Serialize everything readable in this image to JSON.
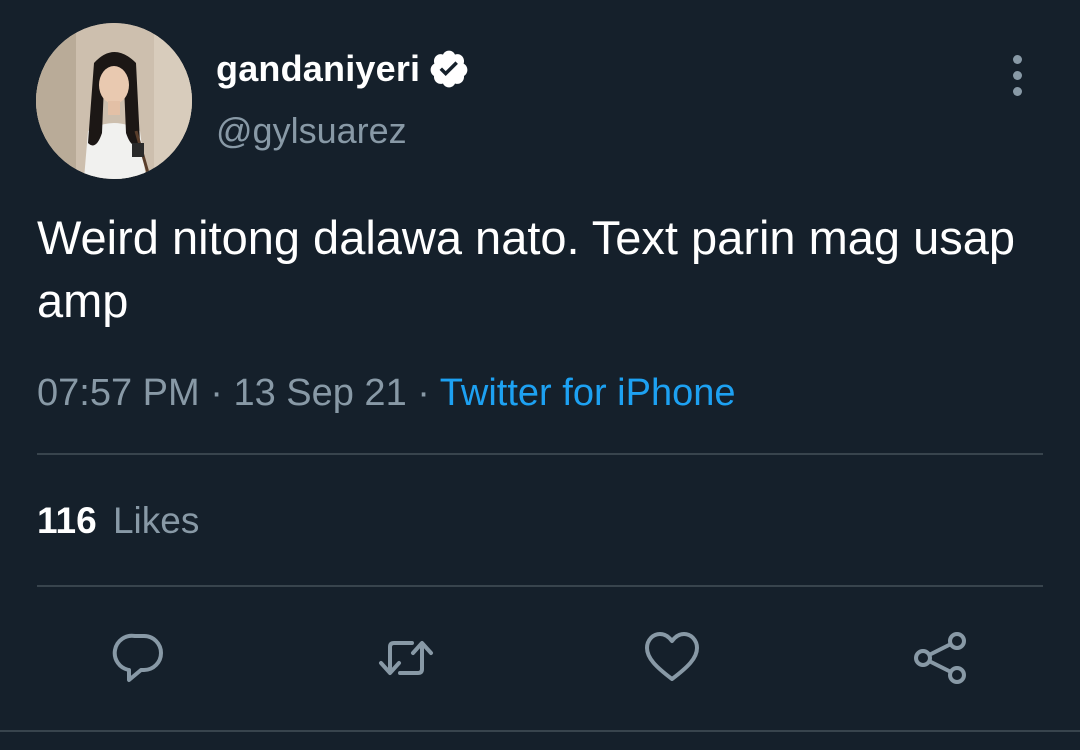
{
  "tweet": {
    "author": {
      "display_name": "gandaniyeri",
      "handle": "@gylsuarez",
      "verified": true,
      "avatar_icon": "profile-photo"
    },
    "text": "Weird nitong dalawa nato. Text parin mag usap amp",
    "time": "07:57 PM",
    "date": "13 Sep 21",
    "separator": "·",
    "source": "Twitter for iPhone",
    "likes": {
      "count": "116",
      "label": "Likes"
    },
    "actions": [
      "reply-icon",
      "retweet-icon",
      "like-icon",
      "share-icon"
    ]
  },
  "colors": {
    "background": "#15202b",
    "text_primary": "#ffffff",
    "text_secondary": "#8899a6",
    "accent": "#1da1f2",
    "divider": "#38444d"
  }
}
